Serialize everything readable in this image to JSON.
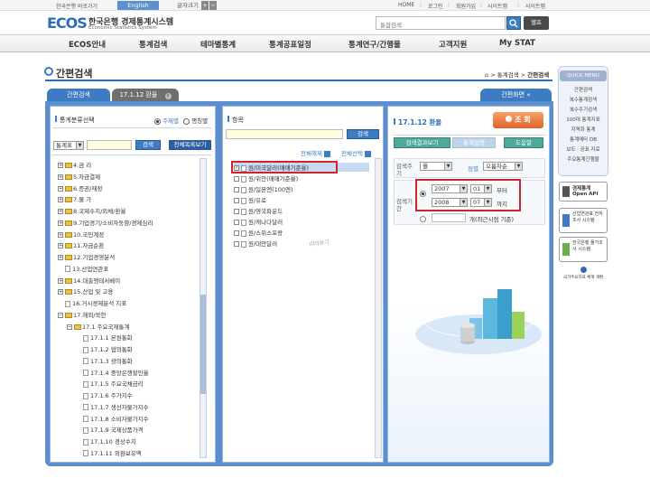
{
  "topbar": {
    "home_link": "한국은행 바로가기",
    "lang": "English",
    "fontsize": "글자크기",
    "plus": "+",
    "minus": "−",
    "links": [
      "HOME",
      "로그인",
      "회원가입",
      "사이트맵",
      "사이트맵"
    ],
    "seps": [
      "|",
      "|",
      "|",
      "|"
    ]
  },
  "brand": {
    "logo": "ECOS",
    "title_ko": "한국은행 경제통계시스템",
    "title_en": "Economic Statistics System"
  },
  "search": {
    "placeholder": "통합검색",
    "help": "헬프"
  },
  "nav": {
    "items": [
      "ECOS안내",
      "통계검색",
      "테마별통계",
      "통계공표일정",
      "통계연구/간행물",
      "고객지원",
      "My STAT"
    ]
  },
  "page": {
    "title": "간편검색",
    "breadcrumb": [
      "통계검색",
      "간편검색"
    ],
    "bc_sep": ">"
  },
  "tabs": {
    "tab1": "간편검색",
    "tab2": "17.1.12 환율",
    "close": "x",
    "right": "간편화면",
    "right_close": "«"
  },
  "left": {
    "heading": "통계분류선택",
    "radio1": "주제별",
    "radio2": "명칭별",
    "dropdown": "통계표",
    "search_btn": "검색",
    "all_btn": "전체목록보기",
    "tree": [
      {
        "pm": "+",
        "label": "4.금 리",
        "lvl": 0
      },
      {
        "pm": "+",
        "label": "5.자금결제",
        "lvl": 0
      },
      {
        "pm": "+",
        "label": "6.증권/재정",
        "lvl": 0
      },
      {
        "pm": "+",
        "label": "7.물 가",
        "lvl": 0
      },
      {
        "pm": "+",
        "label": "8.국제수지/외채/환율",
        "lvl": 0
      },
      {
        "pm": "+",
        "label": "9.기업경기/소비자동향/경제심리",
        "lvl": 0
      },
      {
        "pm": "+",
        "label": "10.국민계정",
        "lvl": 0
      },
      {
        "pm": "+",
        "label": "11.자금순환",
        "lvl": 0
      },
      {
        "pm": "+",
        "label": "12.기업경영분석",
        "lvl": 0
      },
      {
        "pm": "",
        "label": "13.산업연관표",
        "lvl": 0,
        "doc": true
      },
      {
        "pm": "+",
        "label": "14.대출행태서베이",
        "lvl": 0
      },
      {
        "pm": "+",
        "label": "15.산업 및 고용",
        "lvl": 0
      },
      {
        "pm": "",
        "label": "16.거시경제분석 지표",
        "lvl": 0,
        "doc": true
      },
      {
        "pm": "−",
        "label": "17.해외/북한",
        "lvl": 0
      },
      {
        "pm": "−",
        "label": "17.1 주요국제통계",
        "lvl": 1
      },
      {
        "pm": "",
        "label": "17.1.1 본원통화",
        "lvl": 2,
        "doc": true
      },
      {
        "pm": "",
        "label": "17.1.2 협의통화",
        "lvl": 2,
        "doc": true
      },
      {
        "pm": "",
        "label": "17.1.3 광의통화",
        "lvl": 2,
        "doc": true
      },
      {
        "pm": "",
        "label": "17.1.4 중앙은행할인율",
        "lvl": 2,
        "doc": true
      },
      {
        "pm": "",
        "label": "17.1.5 주요국채금리",
        "lvl": 2,
        "doc": true
      },
      {
        "pm": "",
        "label": "17.1.6 주가지수",
        "lvl": 2,
        "doc": true
      },
      {
        "pm": "",
        "label": "17.1.7 생산자물가지수",
        "lvl": 2,
        "doc": true
      },
      {
        "pm": "",
        "label": "17.1.8 소비자물가지수",
        "lvl": 2,
        "doc": true
      },
      {
        "pm": "",
        "label": "17.1.9 국제상품가격",
        "lvl": 2,
        "doc": true
      },
      {
        "pm": "",
        "label": "17.1.10 경상수지",
        "lvl": 2,
        "doc": true
      },
      {
        "pm": "",
        "label": "17.1.11 외환보유액",
        "lvl": 2,
        "doc": true
      }
    ]
  },
  "mid": {
    "heading": "항목",
    "search_btn": "검색",
    "all_release": "전체해제",
    "all_select": "전체선택",
    "items": [
      "원/미국달러(매매기준율)",
      "원/위안(매매기준율)",
      "원/일본엔(100엔)",
      "원/유로",
      "원/영국파운드",
      "원/캐나다달러",
      "원/스위스프랑",
      "원/대만달러"
    ],
    "stamp": "미리보기"
  },
  "right": {
    "title": "17.1.12 환율",
    "query_btn": "조 회",
    "tab1": "검색결과보기",
    "tab2": "통계설명",
    "tab3": "도움말",
    "cycle_label": "검색주기",
    "cycle_value": "월",
    "order_label": "정렬",
    "order_value": "오름차순",
    "period_label": "검색기간",
    "from_year": "2007",
    "from_month": "01",
    "from_suffix": "부터",
    "to_year": "2008",
    "to_month": "07",
    "to_suffix": "까지",
    "recent_suffix": "개(최근시점 기준)",
    "watermark": "Economic Statistics System"
  },
  "quick": {
    "title": "QUICK MENU",
    "items": [
      "간편검색",
      "복수통계검색",
      "복수주기검색",
      "100대 통계지표",
      "지역화 통계",
      "통계메타 DB",
      "보도 · 공표 자료",
      "주요통계간행물"
    ],
    "api": "경제통계 Open API",
    "b2": "산업연관표 전자조사 시스템",
    "b3": "한국은행 물가조사 시스템",
    "footer": "국가주요지표 체계 개편"
  }
}
